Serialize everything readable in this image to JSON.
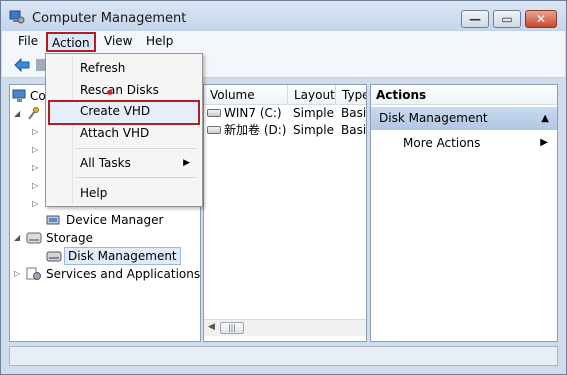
{
  "window": {
    "title": "Computer Management",
    "close_glyph": "✕",
    "min_glyph": "—",
    "max_glyph": "▭"
  },
  "menubar": {
    "file": "File",
    "action": "Action",
    "view": "View",
    "help": "Help"
  },
  "action_menu": {
    "items": [
      {
        "label": "Refresh"
      },
      {
        "label": "Rescan Disks"
      },
      {
        "label": "Create VHD"
      },
      {
        "label": "Attach VHD"
      },
      {
        "label": "All Tasks"
      },
      {
        "label": "Help"
      }
    ]
  },
  "tree": {
    "root_partial": "Co",
    "device_manager": "Device Manager",
    "storage": "Storage",
    "disk_management": "Disk Management",
    "services": "Services and Applications"
  },
  "volumes": {
    "headers": {
      "volume": "Volume",
      "layout": "Layout",
      "type": "Type"
    },
    "rows": [
      {
        "name": "WIN7 (C:)",
        "layout": "Simple",
        "type": "Basic"
      },
      {
        "name": "新加卷 (D:)",
        "layout": "Simple",
        "type": "Basic"
      }
    ]
  },
  "actions": {
    "header": "Actions",
    "section": "Disk Management",
    "more": "More Actions"
  },
  "icons": [
    "app-icon",
    "back-icon",
    "computer-icon",
    "tools-icon",
    "device-manager-icon",
    "storage-icon",
    "disk-management-icon",
    "services-icon",
    "disk-icon"
  ],
  "colors": {
    "highlight_border": "#b01e23",
    "selection": "#c8d9ee"
  }
}
